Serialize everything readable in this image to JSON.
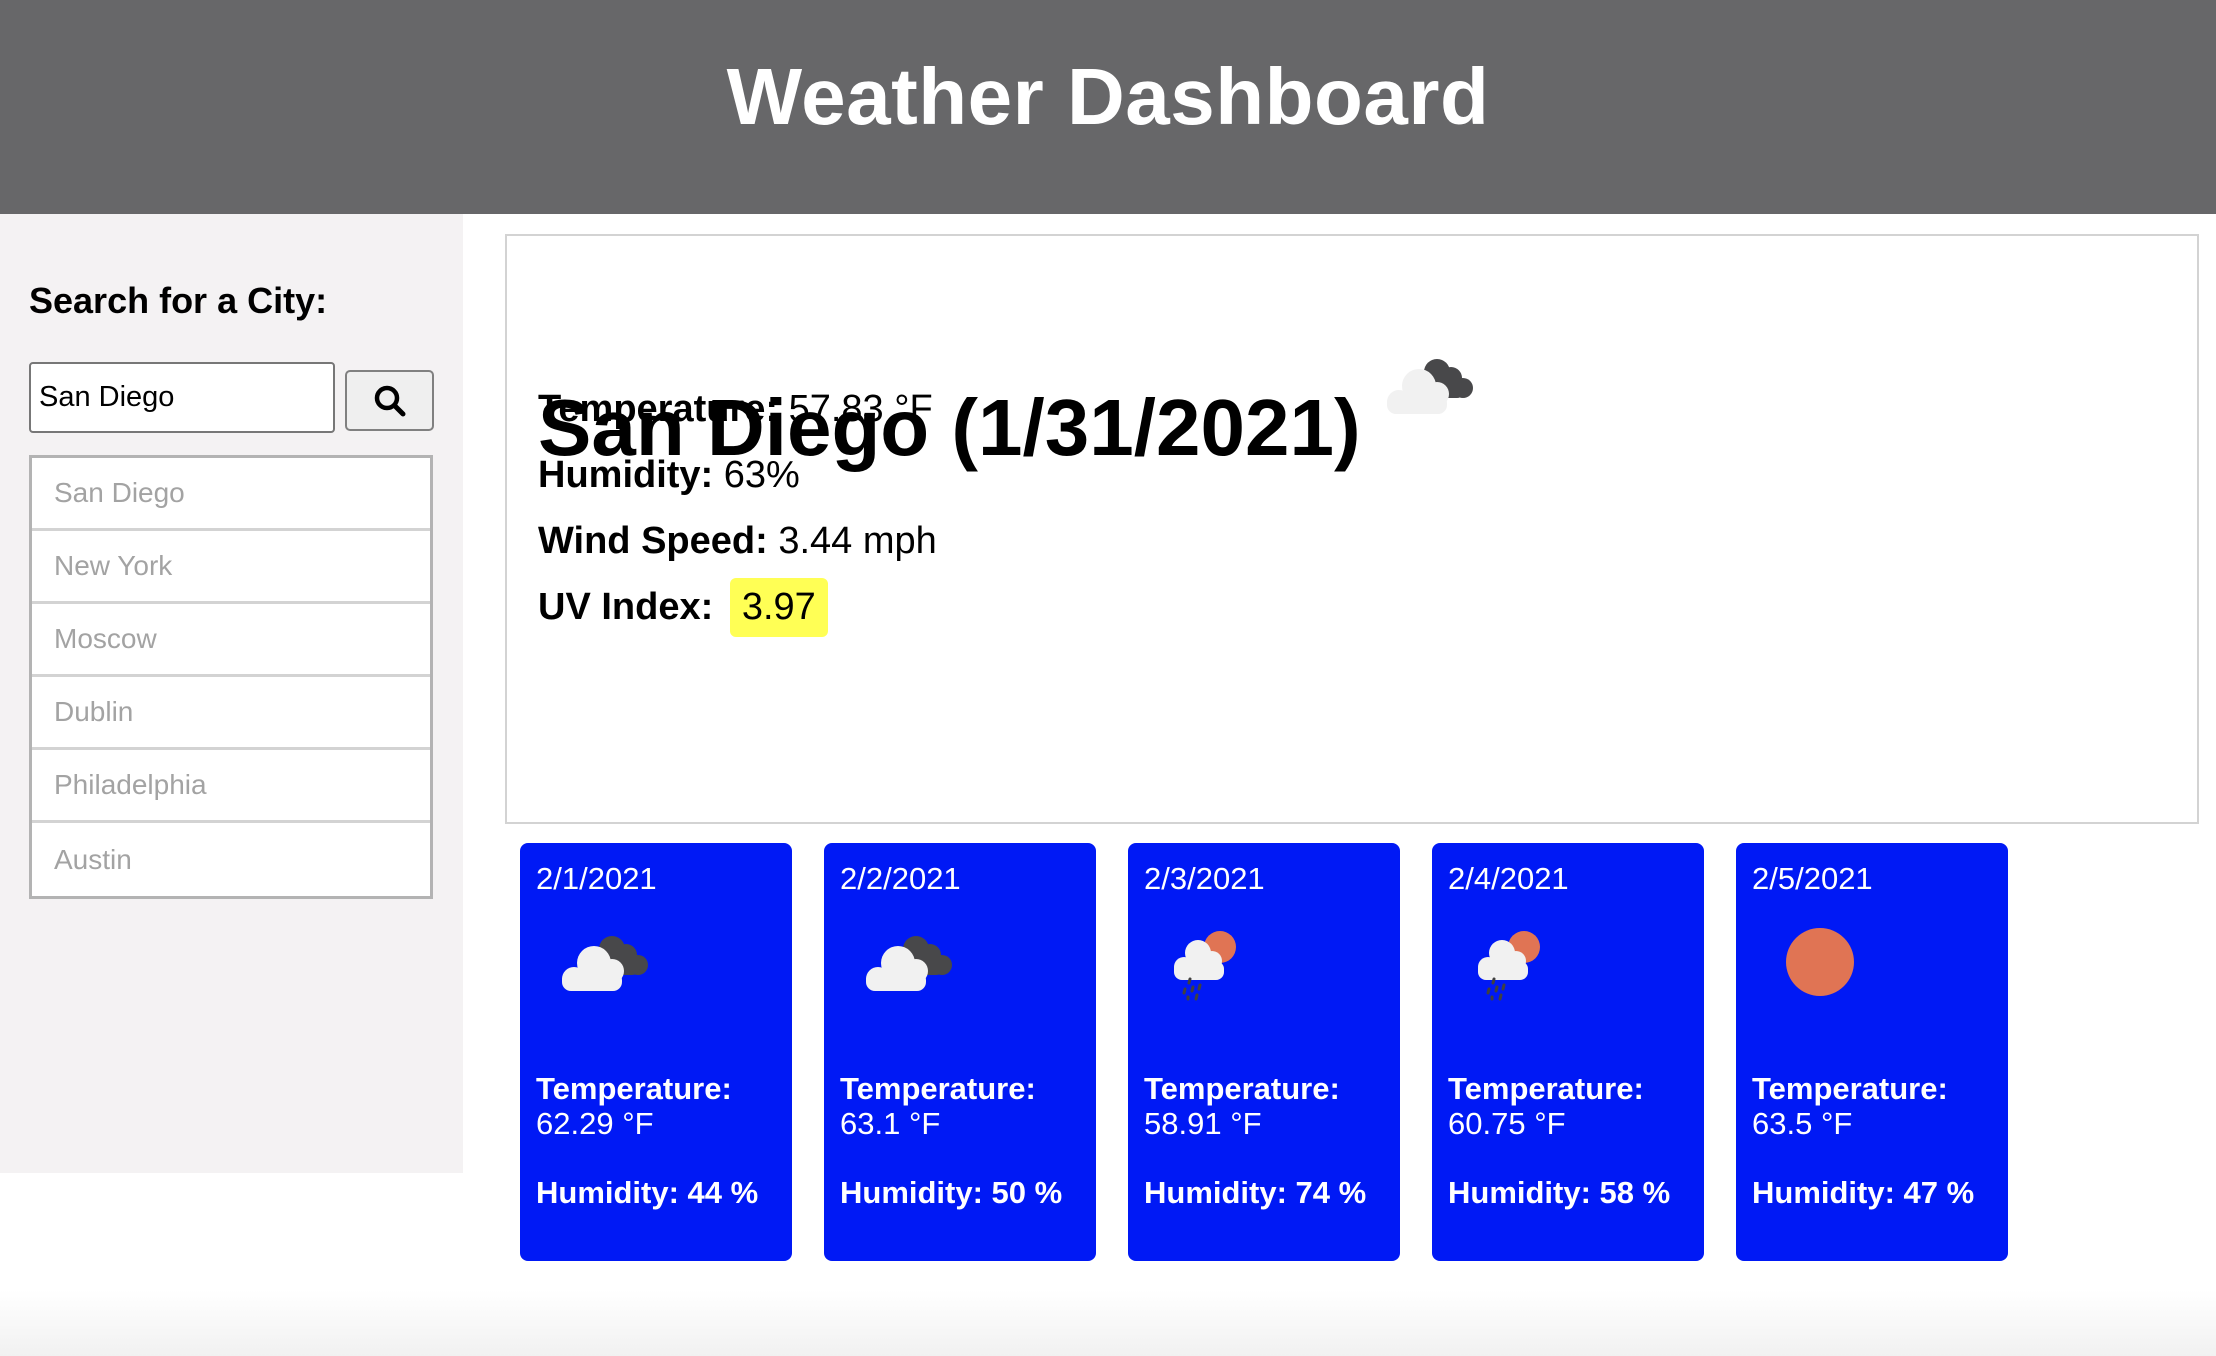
{
  "header": {
    "title": "Weather Dashboard"
  },
  "sidebar": {
    "heading": "Search for a City:",
    "search": {
      "value": "San Diego",
      "button_icon": "search-icon"
    },
    "history": [
      {
        "label": "San Diego"
      },
      {
        "label": "New York"
      },
      {
        "label": "Moscow"
      },
      {
        "label": "Dublin"
      },
      {
        "label": "Philadelphia"
      },
      {
        "label": "Austin"
      }
    ]
  },
  "current": {
    "title": "San Diego (1/31/2021)",
    "icon": "broken-clouds-icon",
    "temperature": {
      "label": "Temperature:",
      "value": "57.83 °F"
    },
    "humidity": {
      "label": "Humidity:",
      "value": "63%"
    },
    "wind": {
      "label": "Wind Speed:",
      "value": "3.44 mph"
    },
    "uv": {
      "label": "UV Index:",
      "value": "3.97",
      "color": "#ffff55"
    }
  },
  "forecast": [
    {
      "date": "2/1/2021",
      "icon": "broken-clouds-icon",
      "temp_label": "Temperature:",
      "temp": "62.29 °F",
      "humidity": "Humidity: 44 %"
    },
    {
      "date": "2/2/2021",
      "icon": "broken-clouds-icon",
      "temp_label": "Temperature:",
      "temp": "63.1 °F",
      "humidity": "Humidity: 50 %"
    },
    {
      "date": "2/3/2021",
      "icon": "rain-sun-icon",
      "temp_label": "Temperature:",
      "temp": "58.91 °F",
      "humidity": "Humidity: 74 %"
    },
    {
      "date": "2/4/2021",
      "icon": "rain-sun-icon",
      "temp_label": "Temperature:",
      "temp": "60.75 °F",
      "humidity": "Humidity: 58 %"
    },
    {
      "date": "2/5/2021",
      "icon": "clear-sun-icon",
      "temp_label": "Temperature:",
      "temp": "63.5 °F",
      "humidity": "Humidity: 47 %"
    }
  ],
  "colors": {
    "header_bg": "#676769",
    "sidebar_bg": "#f4f2f3",
    "card_bg": "#0019f5",
    "uv_badge": "#ffff55",
    "sun": "#e07454"
  }
}
